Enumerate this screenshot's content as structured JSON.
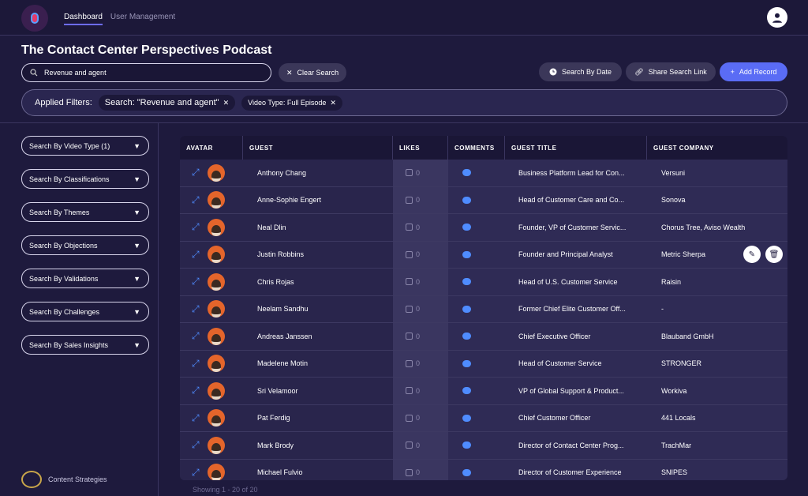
{
  "nav": {
    "dashboard": "Dashboard",
    "user_management": "User Management"
  },
  "page_title": "The Contact Center Perspectives Podcast",
  "search": {
    "value": "Revenue and agent"
  },
  "toolbar": {
    "clear_search": "Clear Search",
    "search_by_date": "Search By Date",
    "share_search_link": "Share Search Link",
    "add_record": "Add Record"
  },
  "filters": {
    "label": "Applied Filters:",
    "chips": [
      "Search: \"Revenue and agent\"",
      "Video Type: Full Episode"
    ]
  },
  "sidebar": {
    "items": [
      "Search By Video Type (1)",
      "Search By Classifications",
      "Search By Themes",
      "Search By Objections",
      "Search By Validations",
      "Search By Challenges",
      "Search By Sales Insights"
    ]
  },
  "brand": {
    "name": "Content Strategies"
  },
  "table": {
    "columns": [
      "AVATAR",
      "GUEST",
      "LIKES",
      "COMMENTS",
      "GUEST TITLE",
      "GUEST COMPANY"
    ],
    "rows": [
      {
        "guest": "Anthony Chang",
        "likes": "0",
        "title": "Business Platform Lead for Con...",
        "company": "Versuni"
      },
      {
        "guest": "Anne-Sophie Engert",
        "likes": "0",
        "title": "Head of Customer Care and Co...",
        "company": "Sonova"
      },
      {
        "guest": "Neal Dlin",
        "likes": "0",
        "title": "Founder, VP of Customer Servic...",
        "company": "Chorus Tree, Aviso Wealth"
      },
      {
        "guest": "Justin Robbins",
        "likes": "0",
        "title": "Founder and Principal Analyst",
        "company": "Metric Sherpa"
      },
      {
        "guest": "Chris Rojas",
        "likes": "0",
        "title": "Head of U.S. Customer Service",
        "company": "Raisin"
      },
      {
        "guest": "Neelam Sandhu",
        "likes": "0",
        "title": "Former Chief Elite Customer Off...",
        "company": "-"
      },
      {
        "guest": "Andreas Janssen",
        "likes": "0",
        "title": "Chief Executive Officer",
        "company": "Blauband GmbH"
      },
      {
        "guest": "Madelene Motin",
        "likes": "0",
        "title": "Head of Customer Service",
        "company": "STRONGER"
      },
      {
        "guest": "Sri Velamoor",
        "likes": "0",
        "title": "VP of Global Support & Product...",
        "company": "Workiva"
      },
      {
        "guest": "Pat Ferdig",
        "likes": "0",
        "title": "Chief Customer Officer",
        "company": "441 Locals"
      },
      {
        "guest": "Mark Brody",
        "likes": "0",
        "title": "Director of Contact Center Prog...",
        "company": "TrachMar"
      },
      {
        "guest": "Michael Fulvio",
        "likes": "0",
        "title": "Director of Customer Experience",
        "company": "SNIPES"
      }
    ]
  },
  "pagination": {
    "showing": "Showing 1 - 20 of 20"
  },
  "colors": {
    "background": "#1e1a3d",
    "accent": "#5a6cf5",
    "link_blue": "#4f8cff",
    "avatar_ring": "#e4652b"
  },
  "icons": {
    "search": "search-icon",
    "clear": "close-icon",
    "date": "clock-icon",
    "share": "link-icon",
    "add": "plus-icon",
    "expand": "expand-icon",
    "like": "thumbs-up-icon",
    "comment": "chat-icon",
    "edit": "edit-icon",
    "delete": "trash-icon"
  }
}
